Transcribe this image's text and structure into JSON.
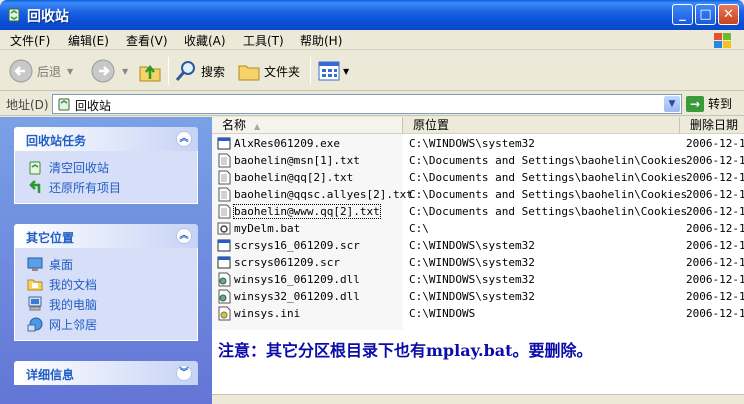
{
  "window": {
    "title": "回收站"
  },
  "menu": [
    "文件(F)",
    "编辑(E)",
    "查看(V)",
    "收藏(A)",
    "工具(T)",
    "帮助(H)"
  ],
  "toolbar": {
    "back": "后退",
    "search": "搜索",
    "folders": "文件夹"
  },
  "address": {
    "label": "地址(D)",
    "value": "回收站",
    "go": "转到"
  },
  "panels": [
    {
      "title": "回收站任务",
      "items": [
        {
          "label": "清空回收站",
          "icon": "empty-bin-icon"
        },
        {
          "label": "还原所有项目",
          "icon": "restore-icon"
        }
      ]
    },
    {
      "title": "其它位置",
      "items": [
        {
          "label": "桌面",
          "icon": "desktop-icon"
        },
        {
          "label": "我的文档",
          "icon": "my-documents-icon"
        },
        {
          "label": "我的电脑",
          "icon": "my-computer-icon"
        },
        {
          "label": "网上邻居",
          "icon": "network-places-icon"
        }
      ]
    },
    {
      "title": "详细信息",
      "items": []
    }
  ],
  "columns": {
    "name": "名称",
    "location": "原位置",
    "deleted": "删除日期"
  },
  "files": [
    {
      "name": "AlxRes061209.exe",
      "location": "C:\\WINDOWS\\system32",
      "date": "2006-12-1",
      "type": "exe"
    },
    {
      "name": "baohelin@msn[1].txt",
      "location": "C:\\Documents and Settings\\baohelin\\Cookies",
      "date": "2006-12-1",
      "type": "txt"
    },
    {
      "name": "baohelin@qq[2].txt",
      "location": "C:\\Documents and Settings\\baohelin\\Cookies",
      "date": "2006-12-1",
      "type": "txt"
    },
    {
      "name": "baohelin@qqsc.allyes[2].txt",
      "location": "C:\\Documents and Settings\\baohelin\\Cookies",
      "date": "2006-12-1",
      "type": "txt"
    },
    {
      "name": "baohelin@www.qq[2].txt",
      "location": "C:\\Documents and Settings\\baohelin\\Cookies",
      "date": "2006-12-1",
      "type": "txt"
    },
    {
      "name": "myDelm.bat",
      "location": "C:\\",
      "date": "2006-12-1",
      "type": "bat"
    },
    {
      "name": "scrsys16_061209.scr",
      "location": "C:\\WINDOWS\\system32",
      "date": "2006-12-1",
      "type": "scr"
    },
    {
      "name": "scrsys061209.scr",
      "location": "C:\\WINDOWS\\system32",
      "date": "2006-12-1",
      "type": "scr"
    },
    {
      "name": "winsys16_061209.dll",
      "location": "C:\\WINDOWS\\system32",
      "date": "2006-12-1",
      "type": "dll"
    },
    {
      "name": "winsys32_061209.dll",
      "location": "C:\\WINDOWS\\system32",
      "date": "2006-12-1",
      "type": "dll"
    },
    {
      "name": "winsys.ini",
      "location": "C:\\WINDOWS",
      "date": "2006-12-1",
      "type": "ini"
    }
  ],
  "note": "注意：其它分区根目录下也有mplay.bat。要删除。",
  "colors": {
    "titlebar": "#0b50d8",
    "taskpane": "#6375d6",
    "link": "#215dc6",
    "note": "#0b0baa"
  }
}
